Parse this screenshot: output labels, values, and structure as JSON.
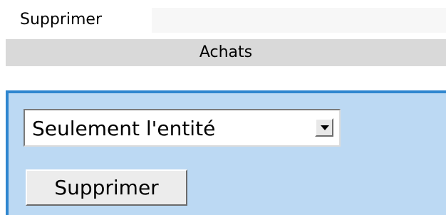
{
  "top": {
    "label": "Supprimer"
  },
  "section": {
    "title": "Achats"
  },
  "delete_form": {
    "scope_options": [
      "Seulement l'entité"
    ],
    "selected_scope": "Seulement l'entité",
    "button_label": "Supprimer"
  },
  "colors": {
    "header_gray": "#d9d9d9",
    "panel_fill": "#bcd9f3",
    "panel_border": "#2f86cf"
  },
  "icons": {
    "dropdown": "chevron-down-icon"
  }
}
